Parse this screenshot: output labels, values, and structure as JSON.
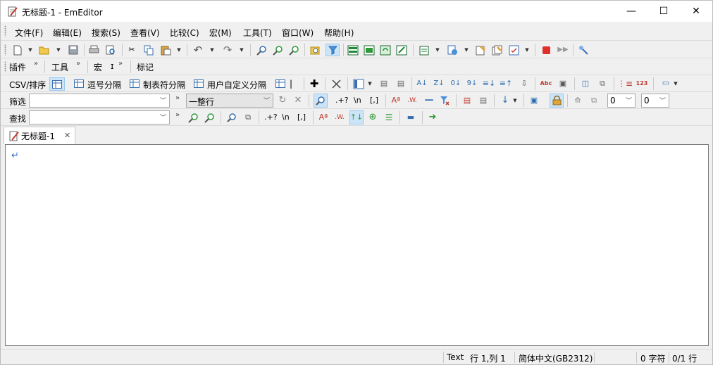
{
  "window": {
    "title": "无标题-1 - EmEditor",
    "minimize": "—",
    "maximize": "☐",
    "close": "✕"
  },
  "menu": [
    "文件(F)",
    "编辑(E)",
    "搜索(S)",
    "查看(V)",
    "比较(C)",
    "宏(M)",
    "工具(T)",
    "窗口(W)",
    "帮助(H)"
  ],
  "toolbars": {
    "plugins": "插件",
    "tools": "工具",
    "macro": "宏",
    "macro_extra": "ɪ",
    "markers": "标记",
    "chevron": "»"
  },
  "csv": {
    "label": "CSV/排序",
    "comma": "逗号分隔",
    "tab": "制表符分隔",
    "user": "用户自定义分隔",
    "pipe": "|"
  },
  "filter": {
    "label": "筛选",
    "value": "",
    "mode": "一整行",
    "regex": ".+?",
    "newline": "\\n",
    "bracket": "[,]",
    "num1": "0",
    "num2": "0"
  },
  "find": {
    "label": "查找",
    "value": "",
    "regex": ".+?",
    "newline": "\\n",
    "bracket": "[,]"
  },
  "tab": {
    "label": "无标题-1",
    "close": "✕"
  },
  "status": {
    "mode": "Text",
    "position": "行 1,列 1",
    "encoding": "简体中文(GB2312)",
    "chars": "0 字符",
    "lines": "0/1 行"
  }
}
